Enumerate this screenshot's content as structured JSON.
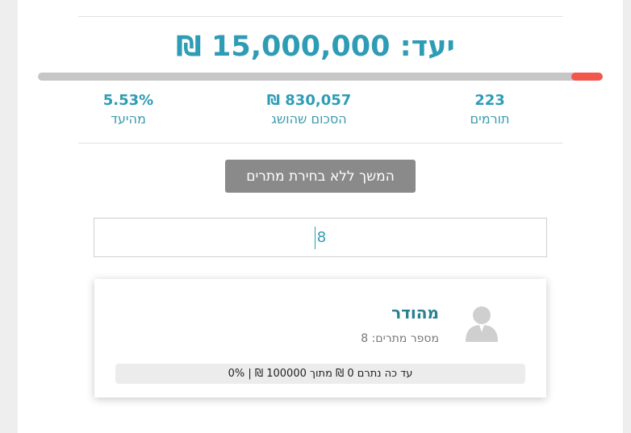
{
  "goal": {
    "text": "יעד: 15,000,000 ₪",
    "progress_percent": 5.53
  },
  "stats": {
    "donors": {
      "value": "223",
      "label": "תורמים"
    },
    "raised": {
      "value": "830,057 ₪",
      "label": "הסכום שהושג"
    },
    "percent": {
      "value": "5.53%",
      "label": "מהיעד"
    }
  },
  "skip_button": {
    "label": "המשך ללא בחירת מתרים"
  },
  "search": {
    "value": "8"
  },
  "card": {
    "title": "מהודר",
    "subtitle": "מספר מתרים: 8",
    "progress_text": "עד כה נתרם 0 ₪ מתוך 100000 ₪ | 0%",
    "avatar_icon": "user-silhouette-icon"
  },
  "colors": {
    "accent": "#2e9cb5",
    "progress": "#f2574c",
    "button": "#8a8a8a"
  }
}
